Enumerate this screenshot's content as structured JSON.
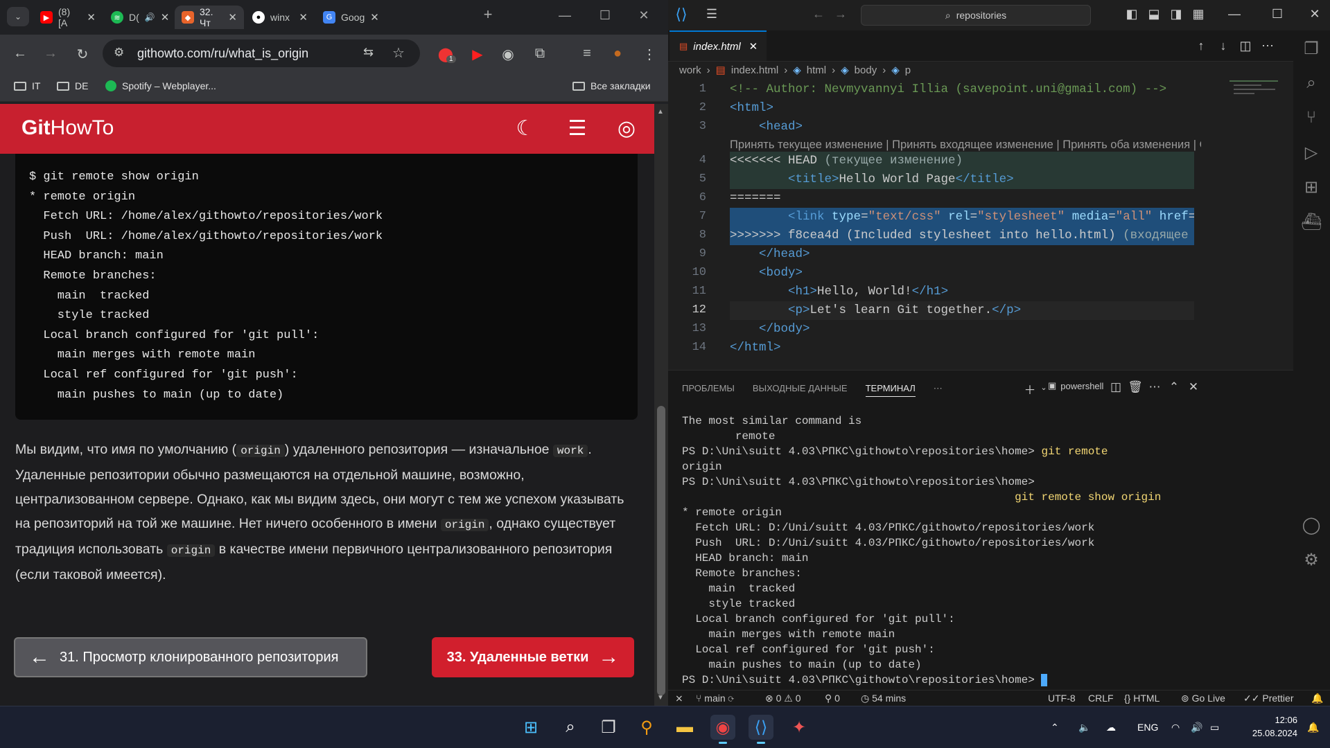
{
  "browser": {
    "tabs": [
      {
        "title": "(8) [A",
        "icon": "youtube-icon"
      },
      {
        "title": "D(",
        "icon": "spotify-icon"
      },
      {
        "title": "32. Чт",
        "icon": "githowto-icon",
        "active": true
      },
      {
        "title": "winx",
        "icon": "github-icon"
      },
      {
        "title": "Goog",
        "icon": "google-translate-icon"
      }
    ],
    "url": "githowto.com/ru/what_is_origin",
    "bookmarks": [
      "IT",
      "DE",
      "Spotify – Webplayer...",
      "Все закладки"
    ],
    "ext_badge": "1"
  },
  "site": {
    "logo_bold": "Git",
    "logo_rest": "HowTo",
    "code_lines": [
      "$ git remote show origin",
      "* remote origin",
      "  Fetch URL: /home/alex/githowto/repositories/work",
      "  Push  URL: /home/alex/githowto/repositories/work",
      "  HEAD branch: main",
      "  Remote branches:",
      "    main  tracked",
      "    style tracked",
      "  Local branch configured for 'git pull':",
      "    main merges with remote main",
      "  Local ref configured for 'git push':",
      "    main pushes to main (up to date)"
    ],
    "para": {
      "p1": "Мы видим, что имя по умолчанию (",
      "c1": "origin",
      "p2": ") удаленного репозитория — изначальное ",
      "c2": "work",
      "p3": ". Удаленные репозитории обычно размещаются на отдельной машине, возможно, централизованном сервере. Однако, как мы видим здесь, они могут с тем же успехом указывать на репозиторий на той же машине. Нет ничего особенного в имени ",
      "c3": "origin",
      "p4": ", однако существует традиция использовать ",
      "c4": "origin",
      "p5": " в качестве имени первичного централизованного репозитория (если таковой имеется)."
    },
    "prev_label": "31. Просмотр клонированного репозитория",
    "next_label": "33. Удаленные ветки"
  },
  "vscode": {
    "search": "repositories",
    "tab_name": "index.html",
    "breadcrumb": [
      "work",
      "index.html",
      "html",
      "body",
      "p"
    ],
    "codelens": "Принять текущее изменение | Принять входящее изменение | Принять оба изменения | Сравнить изменения",
    "line_numbers": [
      "1",
      "2",
      "3",
      "4",
      "5",
      "6",
      "7",
      "8",
      "9",
      "10",
      "11",
      "12",
      "13",
      "14"
    ],
    "code": {
      "l1": "<!-- Author: Nevmyvannyi Illia (savepoint.uni@gmail.com) -->",
      "l4a": "<<<<<<< HEAD",
      "l4b": " (текущее изменение)",
      "l5": "Hello World Page",
      "l6": "=======",
      "l8a": ">>>>>>> f8cea4d (Included stylesheet into hello.html)",
      "l8b": " (входящее изменение)",
      "l11": "Hello, World!",
      "l12": "Let's learn Git together."
    },
    "panel_tabs": [
      "ПРОБЛЕМЫ",
      "ВЫХОДНЫЕ ДАННЫЕ",
      "ТЕРМИНАЛ"
    ],
    "shell": "powershell",
    "terminal": [
      "The most similar command is",
      "        remote",
      "PS D:\\Uni\\suitt 4.03\\РПКС\\githowto\\repositories\\home> ",
      "origin",
      "PS D:\\Uni\\suitt 4.03\\РПКС\\githowto\\repositories\\home>",
      "* remote origin",
      "  Fetch URL: D:/Uni/suitt 4.03/РПКС/githowto/repositories/work",
      "  Push  URL: D:/Uni/suitt 4.03/РПКС/githowto/repositories/work",
      "  HEAD branch: main",
      "  Remote branches:",
      "    main  tracked",
      "    style tracked",
      "  Local branch configured for 'git pull':",
      "    main merges with remote main",
      "  Local ref configured for 'git push':",
      "    main pushes to main (up to date)",
      "PS D:\\Uni\\suitt 4.03\\РПКС\\githowto\\repositories\\home> "
    ],
    "term_cmd1": "git remote",
    "term_cmd2": "git remote show origin",
    "status": {
      "branch": "main",
      "errors": "0",
      "warnings": "0",
      "ports": "0",
      "time": "54 mins",
      "encoding": "UTF-8",
      "eol": "CRLF",
      "lang": "HTML",
      "golive": "Go Live",
      "prettier": "Prettier"
    }
  },
  "taskbar": {
    "lang": "ENG",
    "time": "12:06",
    "date": "25.08.2024"
  },
  "colors": {
    "githowto_red": "#c8202f",
    "vscode_accent": "#0078d4",
    "current_change": "#3b6e60",
    "incoming_change": "#1f4e7a"
  }
}
